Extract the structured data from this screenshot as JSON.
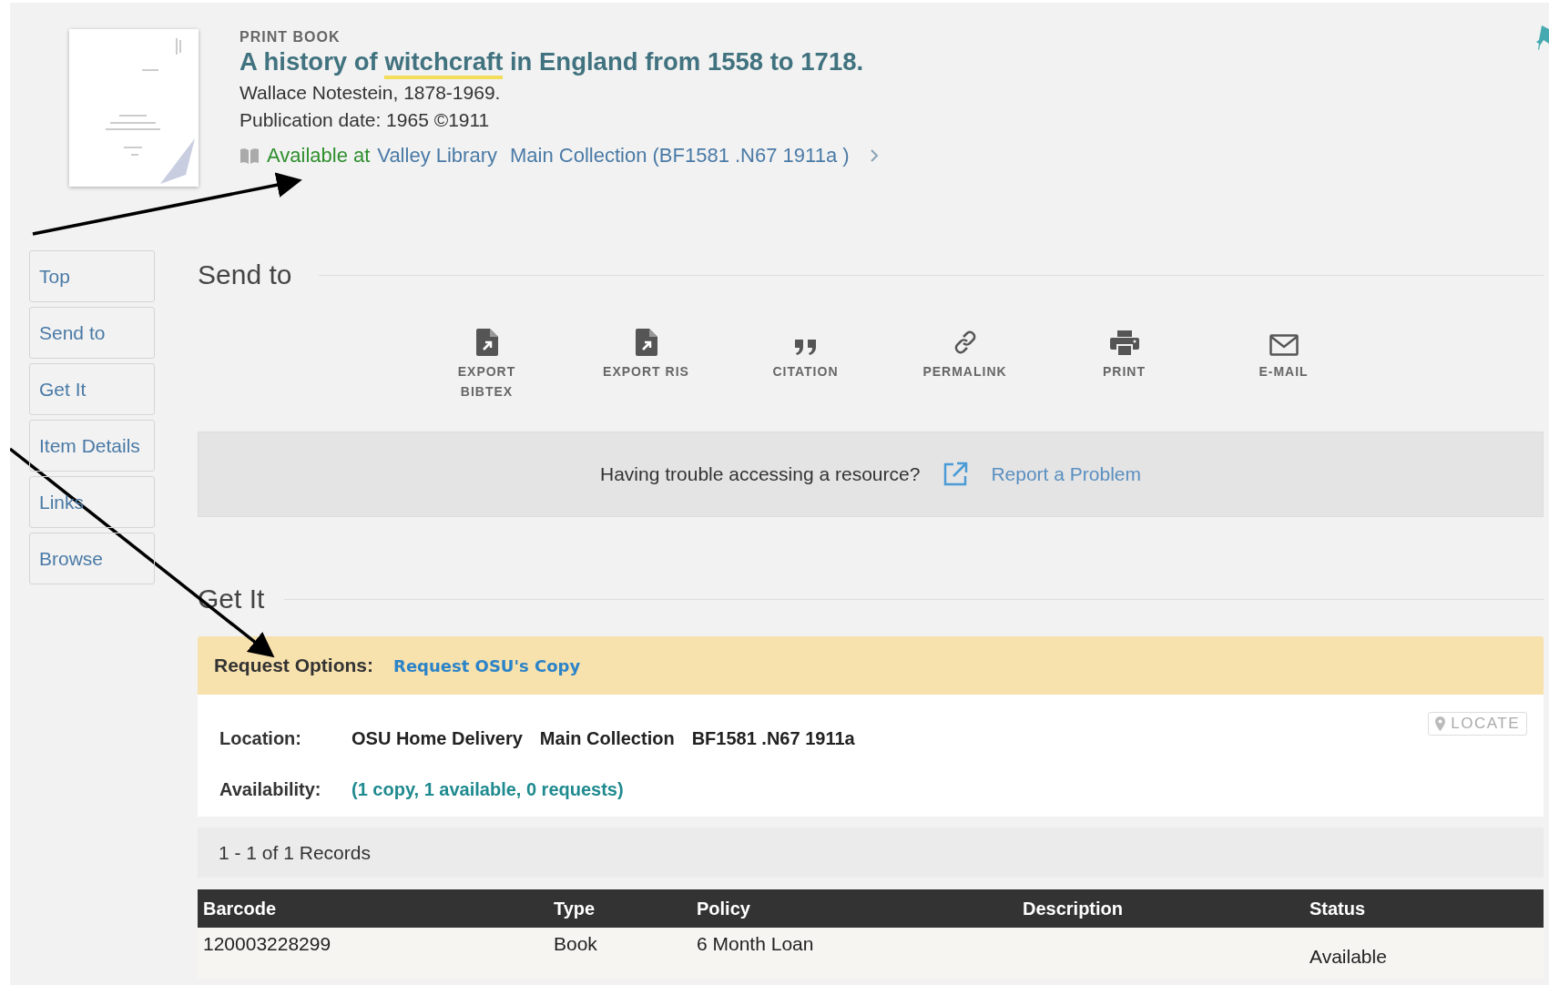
{
  "record": {
    "format": "PRINT BOOK",
    "title_segments": [
      {
        "text": "A history of ",
        "highlighted": false
      },
      {
        "text": "witchcraft",
        "highlighted": true
      },
      {
        "text": " in England from 1558 to 1718.",
        "highlighted": false
      }
    ],
    "author": "Wallace Notestein, 1878-1969.",
    "publication_date": "Publication date: 1965 ©1911",
    "availability": {
      "status": "Available at",
      "library": "Valley Library",
      "location": "Main Collection (BF1581 .N67 1911a )"
    }
  },
  "nav": {
    "items": [
      {
        "label": "Top"
      },
      {
        "label": "Send to"
      },
      {
        "label": "Get It"
      },
      {
        "label": "Item Details"
      },
      {
        "label": "Links"
      },
      {
        "label": "Browse"
      }
    ]
  },
  "send_to": {
    "heading": "Send to",
    "actions": [
      {
        "kind": "file",
        "label": "EXPORT BIBTEX"
      },
      {
        "kind": "file",
        "label": "EXPORT RIS"
      },
      {
        "kind": "quote",
        "label": "CITATION"
      },
      {
        "kind": "link",
        "label": "PERMALINK"
      },
      {
        "kind": "print",
        "label": "PRINT"
      },
      {
        "kind": "mail",
        "label": "E-MAIL"
      }
    ]
  },
  "problem": {
    "question": "Having trouble accessing a resource?",
    "link": "Report a Problem"
  },
  "get_it": {
    "heading": "Get It",
    "request_options": {
      "label": "Request Options:",
      "link": "Request OSU's Copy"
    },
    "location": {
      "label": "Location:",
      "parts": [
        "OSU Home Delivery",
        "Main Collection",
        "BF1581 .N67 1911a"
      ]
    },
    "locate_button": "LOCATE",
    "availability": {
      "label": "Availability:",
      "value": "(1 copy, 1 available, 0 requests)"
    },
    "records": "1 - 1 of 1 Records",
    "table": {
      "columns": [
        "Barcode",
        "Type",
        "Policy",
        "Description",
        "Status"
      ],
      "rows": [
        [
          "120003228299",
          "Book",
          "6 Month Loan",
          "",
          "Available"
        ]
      ]
    }
  }
}
